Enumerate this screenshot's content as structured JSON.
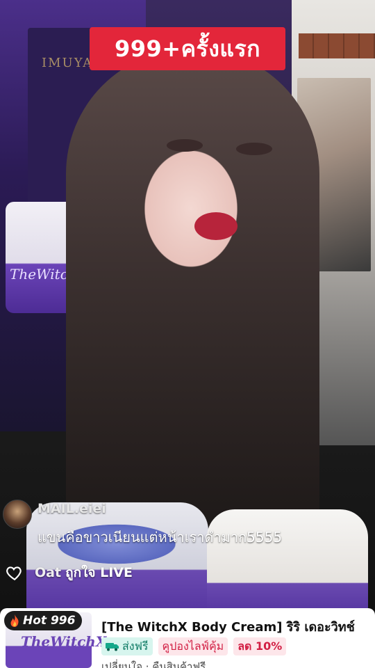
{
  "promo": {
    "text": "999+ครั้งแรก"
  },
  "background": {
    "wall_logo": "IMUYAN"
  },
  "comment": {
    "username": "MAIL.eiei",
    "text": "แขนคือขาวเนียนแต่หน้าเราดำมาก5555"
  },
  "like": {
    "username": "Oat",
    "text": "ถูกใจ LIVE"
  },
  "product_card": {
    "hot_badge": "Hot 996",
    "title": "[The WitchX Body Cream] ริริ เดอะวิทช์",
    "tags": {
      "shipping": "ส่งฟรี",
      "coupon": "คูปองไลฟ์คุ้ม",
      "discount": "ลด 10%"
    },
    "sub_text": "เปลี่ยนใจ · คืนสินค้าฟรี",
    "thumb_script": "TheWitchX"
  },
  "jar_label": "TheWitchX",
  "colors": {
    "promo_red": "#e3263a",
    "brand_purple": "#6b44b8",
    "ship_green": "#0e7a64",
    "discount_red": "#d21f44"
  }
}
